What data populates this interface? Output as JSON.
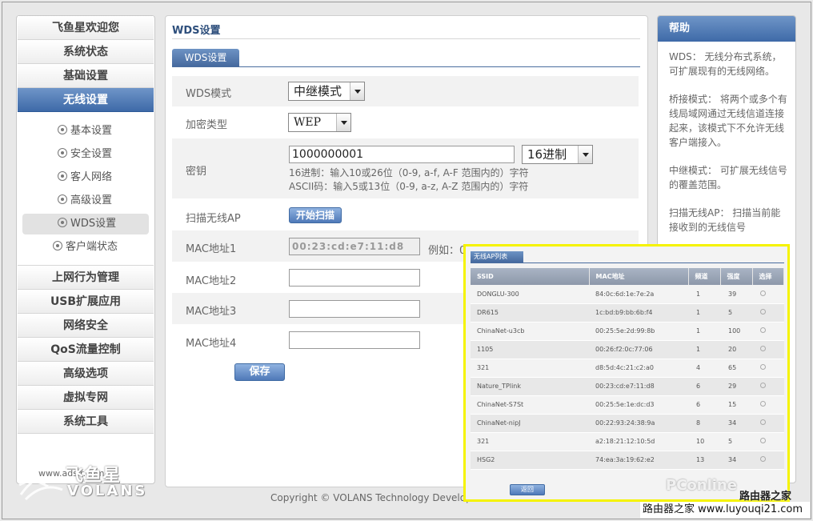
{
  "sidebar": {
    "top_items": [
      "飞鱼星欢迎您",
      "系统状态",
      "基础设置",
      "无线设置"
    ],
    "sub_items": [
      "基本设置",
      "安全设置",
      "客人网络",
      "高级设置",
      "WDS设置",
      "客户端状态"
    ],
    "bottom_items": [
      "上网行为管理",
      "USB扩展应用",
      "网络安全",
      "QoS流量控制",
      "高级选项",
      "虚拟专网",
      "系统工具"
    ],
    "logo_url": "www.adslr.com",
    "logo_cn": "飞鱼星",
    "logo_en": "VOLANS"
  },
  "main": {
    "page_title": "WDS设置",
    "tab_label": "WDS设置",
    "wds_mode_label": "WDS模式",
    "wds_mode_value": "中继模式",
    "encrypt_label": "加密类型",
    "encrypt_value": "WEP",
    "key_label": "密钥",
    "key_value": "1000000001",
    "key_format_value": "16进制",
    "hint_hex": "16进制：输入10或26位（0-9, a-f, A-F 范围内的）字符",
    "hint_ascii": "ASCII码：输入5或13位（0-9, a-z, A-Z 范围内的）字符",
    "scan_label": "扫描无线AP",
    "scan_button": "开始扫描",
    "mac1_label": "MAC地址1",
    "mac1_value": "00:23:cd:e7:11:d8",
    "mac_example": "例如：0",
    "mac2_label": "MAC地址2",
    "mac3_label": "MAC地址3",
    "mac4_label": "MAC地址4",
    "save_button": "保存",
    "copyright": "Copyright © VOLANS Technology Develop"
  },
  "help": {
    "title": "帮助",
    "p1": "WDS： 无线分布式系统，可扩展现有的无线网络。",
    "p2": "桥接模式： 将两个或多个有线局域网通过无线信道连接起来，该模式下不允许无线客户端接入。",
    "p3": "中继模式： 可扩展无线信号的覆盖范围。",
    "p4": "扫描无线AP： 扫描当前能接收到的无线信号"
  },
  "ap_popup": {
    "tab_label": "无线AP列表",
    "headers": [
      "SSID",
      "MAC地址",
      "频道",
      "强度",
      "选择"
    ],
    "rows": [
      [
        "DONGLU-300",
        "84:0c:6d:1e:7e:2a",
        "1",
        "39"
      ],
      [
        "DR615",
        "1c:bd:b9:bb:6b:f4",
        "1",
        "5"
      ],
      [
        "ChinaNet-u3cb",
        "00:25:5e:2d:99:8b",
        "1",
        "100"
      ],
      [
        "1105",
        "00:26:f2:0c:77:06",
        "1",
        "20"
      ],
      [
        "321",
        "d8:5d:4c:21:c2:a0",
        "4",
        "65"
      ],
      [
        "Nature_TPlink",
        "00:23:cd:e7:11:d8",
        "6",
        "29"
      ],
      [
        "ChinaNet-S7St",
        "00:25:5e:1e:dc:d3",
        "6",
        "15"
      ],
      [
        "ChinaNet-nipJ",
        "00:22:93:24:38:9a",
        "8",
        "34"
      ],
      [
        "321",
        "a2:18:21:12:10:5d",
        "10",
        "5"
      ],
      [
        "HSG2",
        "74:ea:3a:19:62:e2",
        "13",
        "34"
      ]
    ],
    "back_button": "返回"
  },
  "watermark": {
    "pconline": "PConline",
    "site_cn": "路由器之家",
    "bottom": "路由器之家 www.luyouqi21.com"
  }
}
